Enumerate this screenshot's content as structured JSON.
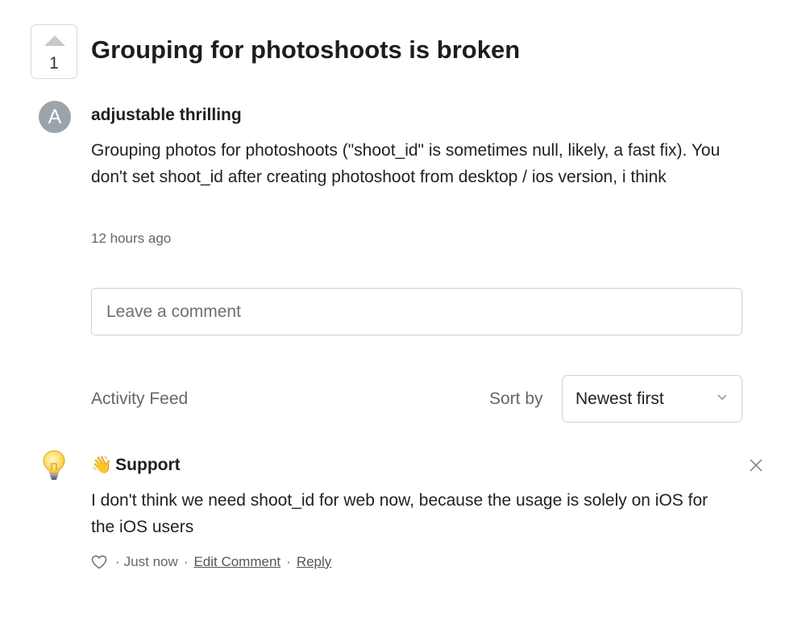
{
  "post": {
    "vote_count": "1",
    "title": "Grouping for photoshoots is broken",
    "author_initial": "A",
    "author_name": "adjustable thrilling",
    "body": "Grouping photos for photoshoots (\"shoot_id\" is sometimes null, likely, a fast fix). You don't set shoot_id after creating photoshoot from desktop / ios version, i think",
    "time": "12 hours ago"
  },
  "comment_box": {
    "placeholder": "Leave a comment"
  },
  "feed": {
    "title": "Activity Feed",
    "sort_label": "Sort by",
    "sort_value": "Newest first"
  },
  "support_comment": {
    "icon": "lightbulb-icon",
    "author_emoji": "👋",
    "author_name": "Support",
    "body": "I don't think we need shoot_id for web now, because the usage is solely on iOS for the iOS users",
    "time": "Just now",
    "separator": "·",
    "edit_label": "Edit Comment",
    "reply_label": "Reply"
  }
}
